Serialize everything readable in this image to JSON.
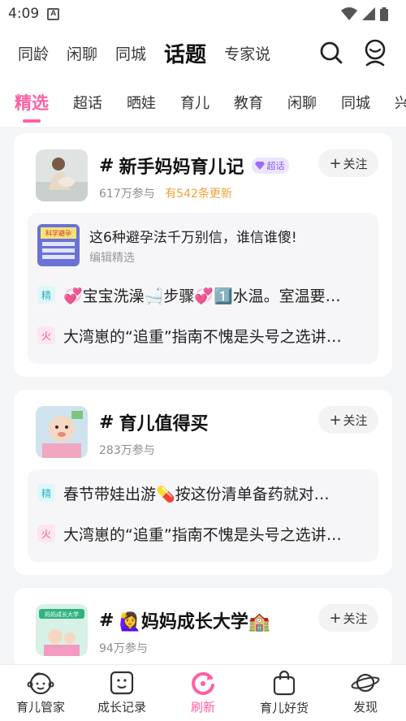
{
  "status": {
    "time": "4:09",
    "app_icon": "A"
  },
  "top_nav": {
    "tabs": [
      "同龄",
      "闲聊",
      "同城",
      "话题",
      "专家说"
    ],
    "active": "话题",
    "icons": [
      "search-icon",
      "profile-icon"
    ]
  },
  "sub_nav": {
    "items": [
      "精选",
      "超话",
      "晒娃",
      "育儿",
      "教育",
      "闲聊",
      "同城",
      "兴"
    ],
    "active": "精选"
  },
  "cards": [
    {
      "hash": "#",
      "title": "新手妈妈育儿记",
      "badge": "超话",
      "participants": "617万参与",
      "update": "有542条更新",
      "follow": "关注",
      "pick": {
        "title": "这6种避孕法千万别信，谁信谁傻!",
        "sub": "编辑精选",
        "thumb_text": "科学避孕"
      },
      "rows": [
        {
          "tag": "精",
          "text": "💞宝宝洗澡🛁步骤💞1️⃣水温。室温要…"
        },
        {
          "tag": "火",
          "text": "大湾崽的“追重”指南不愧是头号之选讲…"
        }
      ]
    },
    {
      "hash": "#",
      "title": "育儿值得买",
      "participants": "283万参与",
      "follow": "关注",
      "rows": [
        {
          "tag": "精",
          "text": "春节带娃出游💊按这份清单备药就对…"
        },
        {
          "tag": "火",
          "text": "大湾崽的“追重”指南不愧是头号之选讲…"
        }
      ]
    },
    {
      "hash": "#",
      "title": "🙋‍♀️妈妈成长大学🏫",
      "participants": "94万参与",
      "follow": "关注",
      "thumb_text": "妈妈成长大学"
    }
  ],
  "bottom_tabs": [
    {
      "label": "育儿管家",
      "icon": "baby-face-icon"
    },
    {
      "label": "成长记录",
      "icon": "photo-icon"
    },
    {
      "label": "刷新",
      "icon": "refresh-icon",
      "active": true
    },
    {
      "label": "育儿好货",
      "icon": "shopping-bag-icon"
    },
    {
      "label": "发现",
      "icon": "planet-icon"
    }
  ],
  "colors": {
    "accent": "#ff5fa5",
    "update": "#f0a13a",
    "badge": "#8a5cf0"
  }
}
